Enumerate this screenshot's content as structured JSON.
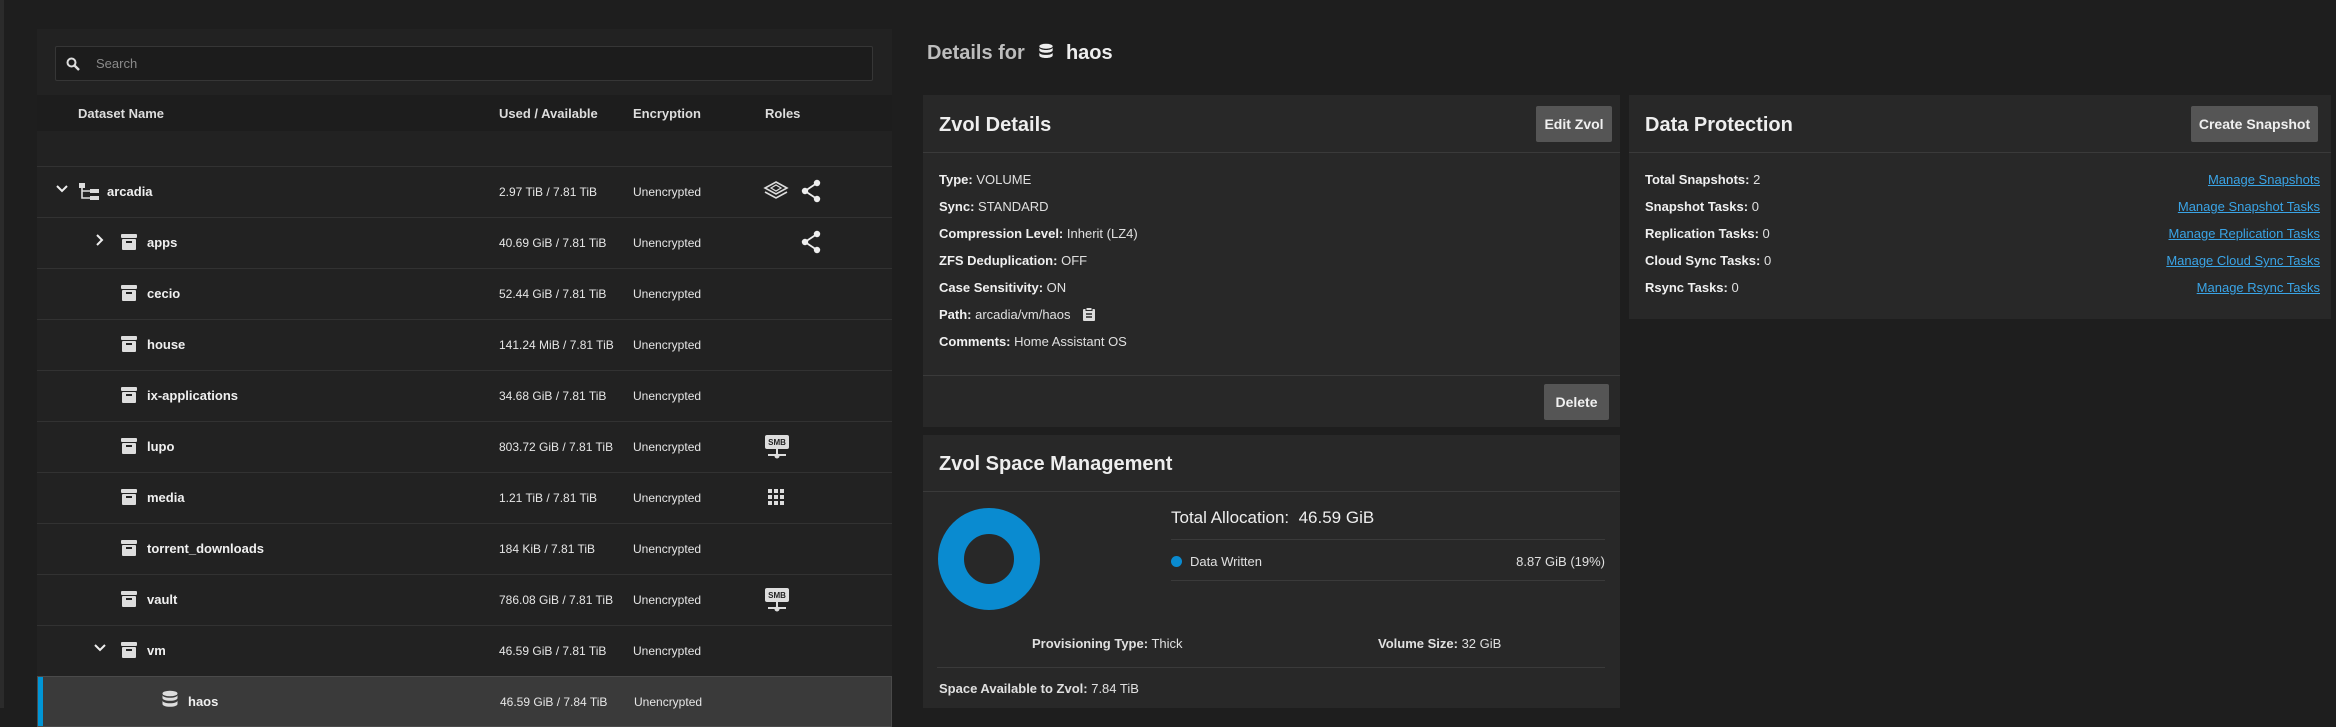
{
  "search": {
    "placeholder": "Search"
  },
  "table": {
    "headers": {
      "name": "Dataset Name",
      "used": "Used / Available",
      "encryption": "Encryption",
      "roles": "Roles"
    },
    "rows": [
      {
        "name": "arcadia",
        "used": "2.97 TiB / 7.81 TiB",
        "encryption": "Unencrypted",
        "icon": "pool-tree-icon",
        "expander": "expanded"
      },
      {
        "name": "apps",
        "used": "40.69 GiB / 7.81 TiB",
        "encryption": "Unencrypted",
        "icon": "dataset-icon",
        "expander": "collapsed"
      },
      {
        "name": "cecio",
        "used": "52.44 GiB / 7.81 TiB",
        "encryption": "Unencrypted",
        "icon": "dataset-icon"
      },
      {
        "name": "house",
        "used": "141.24 MiB / 7.81 TiB",
        "encryption": "Unencrypted",
        "icon": "dataset-icon"
      },
      {
        "name": "ix-applications",
        "used": "34.68 GiB / 7.81 TiB",
        "encryption": "Unencrypted",
        "icon": "dataset-icon"
      },
      {
        "name": "lupo",
        "used": "803.72 GiB / 7.81 TiB",
        "encryption": "Unencrypted",
        "icon": "dataset-icon"
      },
      {
        "name": "media",
        "used": "1.21 TiB / 7.81 TiB",
        "encryption": "Unencrypted",
        "icon": "dataset-icon"
      },
      {
        "name": "torrent_downloads",
        "used": "184 KiB / 7.81 TiB",
        "encryption": "Unencrypted",
        "icon": "dataset-icon"
      },
      {
        "name": "vault",
        "used": "786.08 GiB / 7.81 TiB",
        "encryption": "Unencrypted",
        "icon": "dataset-icon"
      },
      {
        "name": "vm",
        "used": "46.59 GiB / 7.81 TiB",
        "encryption": "Unencrypted",
        "icon": "dataset-icon",
        "expander": "expanded"
      },
      {
        "name": "haos",
        "used": "46.59 GiB / 7.84 TiB",
        "encryption": "Unencrypted",
        "icon": "zvol-icon",
        "selected": true
      }
    ],
    "role_labels": {
      "smb": "SMB"
    }
  },
  "details": {
    "prefix": "Details for",
    "name": "haos"
  },
  "zvol_details": {
    "title": "Zvol Details",
    "edit_label": "Edit Zvol",
    "delete_label": "Delete",
    "fields": [
      {
        "label": "Type:",
        "value": "VOLUME"
      },
      {
        "label": "Sync:",
        "value": "STANDARD"
      },
      {
        "label": "Compression Level:",
        "value": "Inherit (LZ4)"
      },
      {
        "label": "ZFS Deduplication:",
        "value": "OFF"
      },
      {
        "label": "Case Sensitivity:",
        "value": "ON"
      },
      {
        "label": "Path:",
        "value": "arcadia/vm/haos"
      },
      {
        "label": "Comments:",
        "value": "Home Assistant OS"
      }
    ]
  },
  "data_protection": {
    "title": "Data Protection",
    "create_label": "Create Snapshot",
    "rows": [
      {
        "label": "Total Snapshots:",
        "value": "2",
        "link": "Manage Snapshots"
      },
      {
        "label": "Snapshot Tasks:",
        "value": "0",
        "link": "Manage Snapshot Tasks"
      },
      {
        "label": "Replication Tasks:",
        "value": "0",
        "link": "Manage Replication Tasks"
      },
      {
        "label": "Cloud Sync Tasks:",
        "value": "0",
        "link": "Manage Cloud Sync Tasks"
      },
      {
        "label": "Rsync Tasks:",
        "value": "0",
        "link": "Manage Rsync Tasks"
      }
    ]
  },
  "space": {
    "title": "Zvol Space Management",
    "total_label": "Total Allocation:",
    "total_value": "46.59 GiB",
    "legend_label": "Data Written",
    "legend_value": "8.87 GiB (19%)",
    "written_fraction": 1.0,
    "provisioning_label": "Provisioning Type:",
    "provisioning_value": "Thick",
    "volsize_label": "Volume Size:",
    "volsize_value": "32 GiB",
    "available_label": "Space Available to Zvol:",
    "available_value": "7.84 TiB"
  },
  "colors": {
    "accent": "#0095d5",
    "link": "#3aa4e6",
    "donut": "#0a8bd0"
  }
}
